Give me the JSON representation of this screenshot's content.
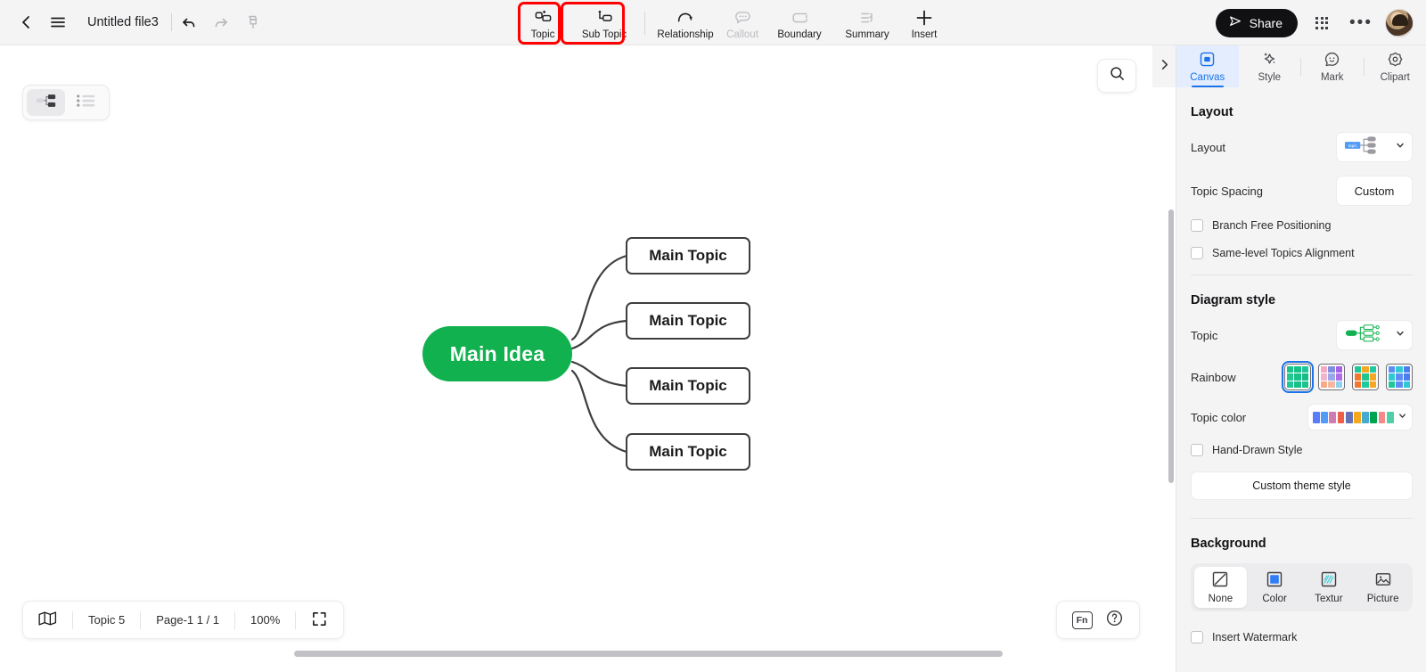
{
  "topbar": {
    "back_icon": "chevron-left-icon",
    "menu_icon": "hamburger-menu-icon",
    "file_title": "Untitled file3",
    "undo_icon": "undo-icon",
    "redo_icon": "redo-icon",
    "format_painter_icon": "format-painter-icon",
    "tools": [
      {
        "label": "Topic",
        "icon": "topic-icon",
        "disabled": false,
        "highlighted": true
      },
      {
        "label": "Sub Topic",
        "icon": "sub-topic-icon",
        "disabled": false,
        "highlighted": true
      },
      {
        "label": "Relationship",
        "icon": "relationship-icon",
        "disabled": false,
        "highlighted": false
      },
      {
        "label": "Callout",
        "icon": "callout-icon",
        "disabled": true,
        "highlighted": false
      },
      {
        "label": "Boundary",
        "icon": "boundary-icon",
        "disabled": true,
        "highlighted": false
      },
      {
        "label": "Summary",
        "icon": "summary-icon",
        "disabled": true,
        "highlighted": false
      },
      {
        "label": "Insert",
        "icon": "plus-icon",
        "disabled": false,
        "highlighted": false
      }
    ],
    "share_label": "Share",
    "share_icon": "send-plane-icon",
    "apps_icon": "grid-apps-icon",
    "more_icon": "more-horizontal-icon",
    "avatar_icon": "user-avatar"
  },
  "canvas": {
    "view_toggle": {
      "mindmap_icon": "mindmap-view-icon",
      "outline_icon": "outline-view-icon",
      "active": "mindmap"
    },
    "search_icon": "search-icon",
    "mindmap": {
      "root": {
        "label": "Main Idea",
        "color": "#12b14f",
        "text_color": "#ffffff"
      },
      "topics": [
        {
          "label": "Main Topic"
        },
        {
          "label": "Main Topic"
        },
        {
          "label": "Main Topic"
        },
        {
          "label": "Main Topic"
        }
      ],
      "branch_color": "#3e3e42"
    }
  },
  "statusbar": {
    "map_icon": "map-overview-icon",
    "topic_count": "Topic 5",
    "page_label": "Page-1  1 / 1",
    "zoom_level": "100%",
    "fullscreen_icon": "fullscreen-icon",
    "fn_label": "Fn",
    "help_icon": "help-circle-icon"
  },
  "panel": {
    "collapse_icon": "chevron-right-icon",
    "tabs": [
      {
        "label": "Canvas",
        "icon": "canvas-icon",
        "active": true
      },
      {
        "label": "Style",
        "icon": "sparkle-icon",
        "active": false
      },
      {
        "label": "Mark",
        "icon": "smiley-icon",
        "active": false
      },
      {
        "label": "Clipart",
        "icon": "clipart-flower-icon",
        "active": false
      }
    ],
    "layout": {
      "title": "Layout",
      "layout_label": "Layout",
      "layout_value_icon": "layout-preview-right-map",
      "layout_preview_text": "topic",
      "spacing_label": "Topic Spacing",
      "spacing_value": "Custom",
      "checkboxes": [
        {
          "label": "Branch Free Positioning",
          "checked": false
        },
        {
          "label": "Same-level Topics Alignment",
          "checked": false
        }
      ]
    },
    "diagram_style": {
      "title": "Diagram style",
      "topic_label": "Topic",
      "topic_value_icon": "topic-style-preview-green",
      "rainbow_label": "Rainbow",
      "rainbow_swatches": [
        {
          "selected": true,
          "colors": [
            "#18c38c",
            "#16c088",
            "#1ec79a",
            "#21c98e",
            "#19c08a",
            "#13bd86",
            "#1ec79a",
            "#16c088",
            "#18c38c"
          ]
        },
        {
          "selected": false,
          "colors": [
            "#f2a9c4",
            "#7f8fe0",
            "#a55fe8",
            "#f0b5ce",
            "#9aa7e8",
            "#b06de8",
            "#f7a98a",
            "#f4b8a0",
            "#8fd0f0"
          ]
        },
        {
          "selected": false,
          "colors": [
            "#1ec79a",
            "#f5a623",
            "#20c9a0",
            "#f2762e",
            "#1fc58f",
            "#f5a623",
            "#f2762e",
            "#20c9a0",
            "#f5a623"
          ]
        },
        {
          "selected": false,
          "colors": [
            "#5b8df5",
            "#2fc9d6",
            "#4a7ef0",
            "#2fc9d6",
            "#5b8df5",
            "#4a7ef0",
            "#1ec79a",
            "#5b8df5",
            "#2fc9d6"
          ]
        }
      ],
      "topic_color_label": "Topic color",
      "topic_colors": [
        "#5b7cfa",
        "#4f9bf7",
        "#cf7cb0",
        "#ef5f48",
        "#6572b5",
        "#f5a81c",
        "#46aace",
        "#00a450",
        "#f28a8a",
        "#4ecfa8"
      ],
      "hand_drawn_label": "Hand-Drawn Style",
      "hand_drawn_checked": false,
      "custom_theme_label": "Custom theme style"
    },
    "background": {
      "title": "Background",
      "options": [
        {
          "label": "None",
          "icon": "none-slash-icon",
          "active": true
        },
        {
          "label": "Color",
          "icon": "color-square-icon",
          "active": false
        },
        {
          "label": "Textur",
          "icon": "texture-icon",
          "active": false
        },
        {
          "label": "Picture",
          "icon": "picture-icon",
          "active": false
        }
      ],
      "watermark_label": "Insert Watermark",
      "watermark_checked": false
    }
  }
}
